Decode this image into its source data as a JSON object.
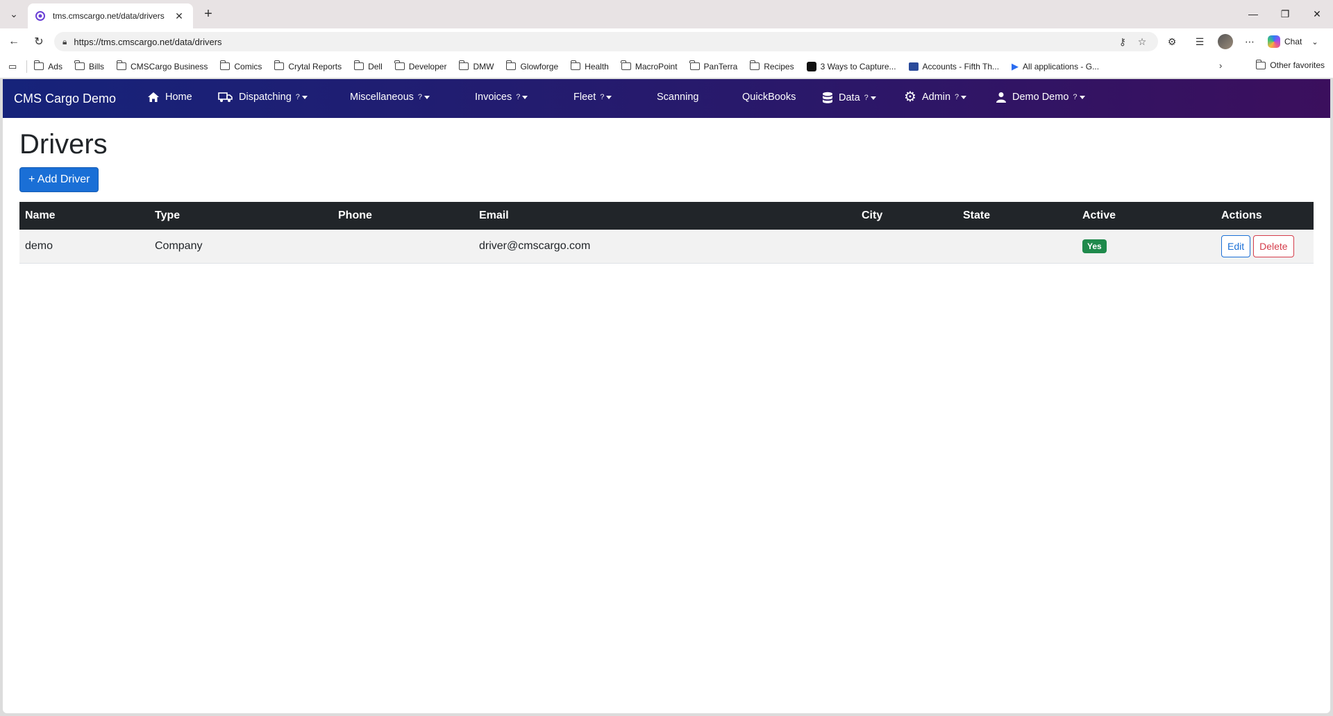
{
  "browser": {
    "tab_title": "tms.cmscargo.net/data/drivers",
    "url": "https://tms.cmscargo.net/data/drivers",
    "chat_label": "Chat",
    "bookmarks": [
      "Ads",
      "Bills",
      "CMSCargo Business",
      "Comics",
      "Crytal Reports",
      "Dell",
      "Developer",
      "DMW",
      "Glowforge",
      "Health",
      "MacroPoint",
      "PanTerra",
      "Recipes",
      "3 Ways to Capture...",
      "Accounts - Fifth Th...",
      "All applications - G..."
    ],
    "other_favorites": "Other favorites"
  },
  "app": {
    "brand": "CMS Cargo Demo",
    "nav": {
      "home": "Home",
      "dispatching": "Dispatching",
      "miscellaneous": "Miscellaneous",
      "invoices": "Invoices",
      "fleet": "Fleet",
      "scanning": "Scanning",
      "quickbooks": "QuickBooks",
      "data": "Data",
      "admin": "Admin",
      "user": "Demo Demo",
      "help_mark": "?"
    }
  },
  "page": {
    "title": "Drivers",
    "add_button": "+ Add Driver"
  },
  "table": {
    "headers": [
      "Name",
      "Type",
      "Phone",
      "Email",
      "City",
      "State",
      "Active",
      "Actions"
    ],
    "rows": [
      {
        "name": "demo",
        "type": "Company",
        "phone": "",
        "email": "driver@cmscargo.com",
        "city": "",
        "state": "",
        "active": "Yes",
        "edit": "Edit",
        "delete": "Delete"
      }
    ]
  }
}
